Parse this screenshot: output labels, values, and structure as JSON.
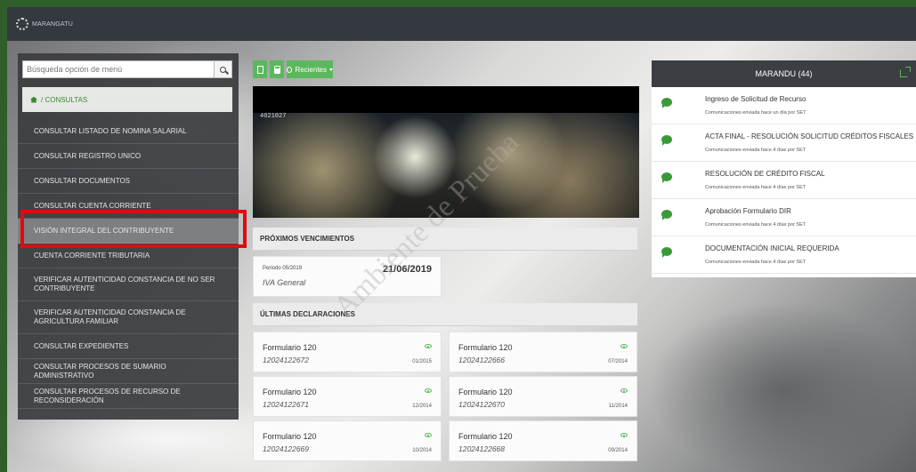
{
  "app": {
    "name": "MARANGATU"
  },
  "sidebar": {
    "search_placeholder": "Búsqueda opción de menú",
    "breadcrumb": "/ CONSULTAS",
    "items": [
      {
        "label": "CONSULTAR LISTADO DE NOMINA SALARIAL"
      },
      {
        "label": "CONSULTAR REGISTRO UNICO"
      },
      {
        "label": "CONSULTAR DOCUMENTOS"
      },
      {
        "label": "CONSULTAR CUENTA CORRIENTE"
      },
      {
        "label": "VISIÓN INTEGRAL DEL CONTRIBUYENTE"
      },
      {
        "label": "CUENTA CORRIENTE TRIBUTARIA"
      },
      {
        "label": "VERIFICAR AUTENTICIDAD CONSTANCIA DE NO SER CONTRIBUYENTE"
      },
      {
        "label": "VERIFICAR AUTENTICIDAD CONSTANCIA DE AGRICULTURA FAMILIAR"
      },
      {
        "label": "CONSULTAR EXPEDIENTES"
      },
      {
        "label": "CONSULTAR PROCESOS DE SUMARIO ADMINISTRATIVO"
      },
      {
        "label": "CONSULTAR PROCESOS DE RECURSO DE RECONSIDERACIÓN"
      }
    ]
  },
  "toolbar": {
    "recientes_label": "Recientes"
  },
  "banner": {
    "label": "4021027"
  },
  "vencimientos": {
    "title": "PRÓXIMOS VENCIMIENTOS",
    "period": "Periodo 05/2019",
    "tax": "IVA General",
    "date": "21/06/2019"
  },
  "declaraciones": {
    "title": "ÚLTIMAS DECLARACIONES",
    "cards": [
      {
        "title": "Formulario 120",
        "number": "12024122672",
        "period": "01/2015"
      },
      {
        "title": "Formulario 120",
        "number": "12024122666",
        "period": "07/2014"
      },
      {
        "title": "Formulario 120",
        "number": "12024122671",
        "period": "12/2014"
      },
      {
        "title": "Formulario 120",
        "number": "12024122670",
        "period": "11/2014"
      },
      {
        "title": "Formulario 120",
        "number": "12024122669",
        "period": "10/2014"
      },
      {
        "title": "Formulario 120",
        "number": "12024122668",
        "period": "09/2014"
      }
    ]
  },
  "watermark": "Ambiente de Prueba",
  "marandu": {
    "title": "MARANDU (44)",
    "items": [
      {
        "title": "Ingreso de Solicitud de Recurso",
        "sub": "Comunicaciones enviada hace un día por SET"
      },
      {
        "title": "ACTA FINAL - RESOLUCIÓN SOLICITUD CRÉDITOS FISCALES",
        "sub": "Comunicaciones enviada hace 4 días por SET"
      },
      {
        "title": "RESOLUCIÓN DE CRÉDITO FISCAL",
        "sub": "Comunicaciones enviada hace 4 días por SET"
      },
      {
        "title": "Aprobación Formulario DIR",
        "sub": "Comunicaciones enviada hace 4 días por SET"
      },
      {
        "title": "DOCUMENTACIÓN INICIAL REQUERIDA",
        "sub": "Comunicaciones enviada hace 4 días por SET"
      }
    ]
  },
  "colors": {
    "accent": "#5cb85c",
    "highlight": "#e10b0b",
    "topbar": "#34393f"
  }
}
